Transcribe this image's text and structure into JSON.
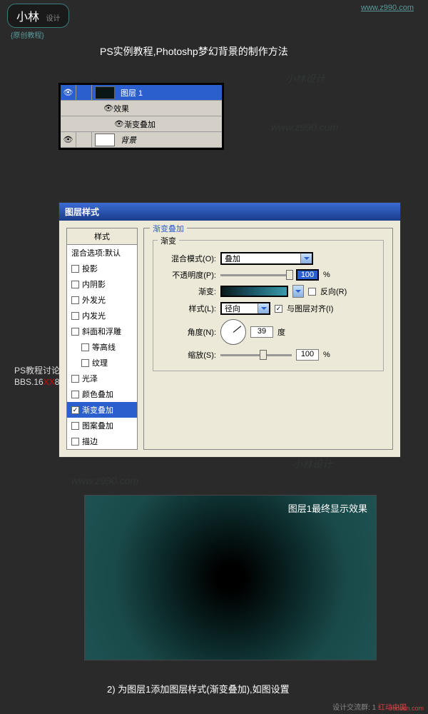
{
  "header": {
    "logo_main": "小林",
    "logo_sub1": "设计",
    "logo_sub2": "{原创教程}",
    "url": "www.z990.com"
  },
  "title": "PS实例教程,Photoshp梦幻背景的制作方法",
  "layers_panel": {
    "layer1": "图层 1",
    "effects": "效果",
    "gradient_overlay": "渐变叠加",
    "background": "背景"
  },
  "dialog": {
    "title": "图层样式",
    "styles_header": "样式",
    "styles": {
      "blend_default": "混合选项:默认",
      "drop_shadow": "投影",
      "inner_shadow": "内阴影",
      "outer_glow": "外发光",
      "inner_glow": "内发光",
      "bevel": "斜面和浮雕",
      "contour": "等高线",
      "texture": "纹理",
      "satin": "光泽",
      "color_overlay": "颜色叠加",
      "gradient_overlay": "渐变叠加",
      "pattern_overlay": "图案叠加",
      "stroke": "描边"
    },
    "settings": {
      "section_title": "渐变叠加",
      "fieldset_title": "渐变",
      "blend_mode_label": "混合模式(O):",
      "blend_mode_value": "叠加",
      "opacity_label": "不透明度(P):",
      "opacity_value": "100",
      "opacity_unit": "%",
      "gradient_label": "渐变:",
      "reverse_label": "反向(R)",
      "style_label": "样式(L):",
      "style_value": "径向",
      "align_label": "与图层对齐(I)",
      "angle_label": "角度(N):",
      "angle_value": "39",
      "angle_unit": "度",
      "scale_label": "缩放(S):",
      "scale_value": "100",
      "scale_unit": "%"
    }
  },
  "result": {
    "label": "图层1最终显示效果"
  },
  "caption": "2) 为图层1添加图层样式(渐变叠加),如图设置",
  "sidebar": {
    "line1": "PS教程讨论",
    "line2_a": "BBS.16",
    "line2_b": "XX",
    "line2_c": "8"
  },
  "footer": {
    "text": "设计交流群: 1",
    "brand": "红动中国",
    "logo": "redocn.com"
  },
  "watermarks": {
    "w1": "小林设计",
    "w2": "www.z990.com"
  }
}
